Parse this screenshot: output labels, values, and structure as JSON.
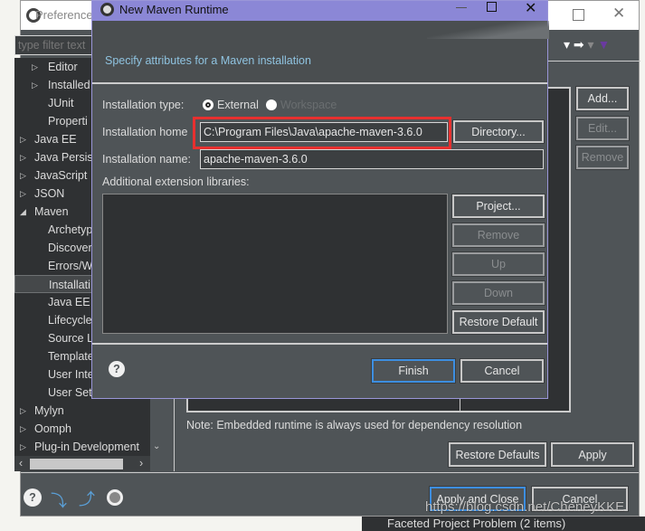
{
  "preferences": {
    "title": "Preferences",
    "filter_placeholder": "type filter text",
    "tree": [
      {
        "label": "Editor",
        "level": 1,
        "arrow": "▷"
      },
      {
        "label": "Installed",
        "level": 1,
        "arrow": "▷"
      },
      {
        "label": "JUnit",
        "level": 1,
        "arrow": ""
      },
      {
        "label": "Properti",
        "level": 1,
        "arrow": ""
      },
      {
        "label": "Java EE",
        "level": 0,
        "arrow": "▷"
      },
      {
        "label": "Java Persist",
        "level": 0,
        "arrow": "▷"
      },
      {
        "label": "JavaScript",
        "level": 0,
        "arrow": "▷"
      },
      {
        "label": "JSON",
        "level": 0,
        "arrow": "▷"
      },
      {
        "label": "Maven",
        "level": 0,
        "arrow": "◢"
      },
      {
        "label": "Archetyp",
        "level": 1,
        "arrow": ""
      },
      {
        "label": "Discover",
        "level": 1,
        "arrow": ""
      },
      {
        "label": "Errors/W",
        "level": 1,
        "arrow": ""
      },
      {
        "label": "Installati",
        "level": 1,
        "arrow": "",
        "selected": true
      },
      {
        "label": "Java EE",
        "level": 1,
        "arrow": ""
      },
      {
        "label": "Lifecycle",
        "level": 1,
        "arrow": ""
      },
      {
        "label": "Source L",
        "level": 1,
        "arrow": ""
      },
      {
        "label": "Template",
        "level": 1,
        "arrow": ""
      },
      {
        "label": "User Inte",
        "level": 1,
        "arrow": ""
      },
      {
        "label": "User Set",
        "level": 1,
        "arrow": ""
      },
      {
        "label": "Mylyn",
        "level": 0,
        "arrow": "▷"
      },
      {
        "label": "Oomph",
        "level": 0,
        "arrow": "▷"
      },
      {
        "label": "Plug-in Development",
        "level": 0,
        "arrow": "▷"
      }
    ],
    "side_buttons": {
      "add": "Add...",
      "edit": "Edit...",
      "remove": "Remove"
    },
    "note": "Note: Embedded runtime is always used for dependency resolution",
    "restore_defaults": "Restore Defaults",
    "apply": "Apply",
    "apply_and_close": "Apply and Close",
    "cancel": "Cancel",
    "status_text": "Faceted Project Problem (2 items)"
  },
  "dialog": {
    "title": "New Maven Runtime",
    "subtitle": "Specify attributes for a Maven installation",
    "installation_type_label": "Installation type:",
    "type_external": "External",
    "type_workspace": "Workspace",
    "selected_type": "External",
    "installation_home_label": "Installation home",
    "installation_home_value": "C:\\Program Files\\Java\\apache-maven-3.6.0",
    "directory_button": "Directory...",
    "installation_name_label": "Installation name:",
    "installation_name_value": "apache-maven-3.6.0",
    "extension_libraries_label": "Additional extension libraries:",
    "list_buttons": {
      "project": "Project...",
      "remove": "Remove",
      "up": "Up",
      "down": "Down",
      "restore_default": "Restore Default"
    },
    "finish": "Finish",
    "cancel": "Cancel"
  },
  "watermark": "https://blog.csdn.net/CheneyKKE",
  "colors": {
    "title_bar": "#8b87d6",
    "highlight": "#e8302f",
    "body": "#4f5457",
    "tree": "#2f3133",
    "link": "#8fc3e0"
  }
}
